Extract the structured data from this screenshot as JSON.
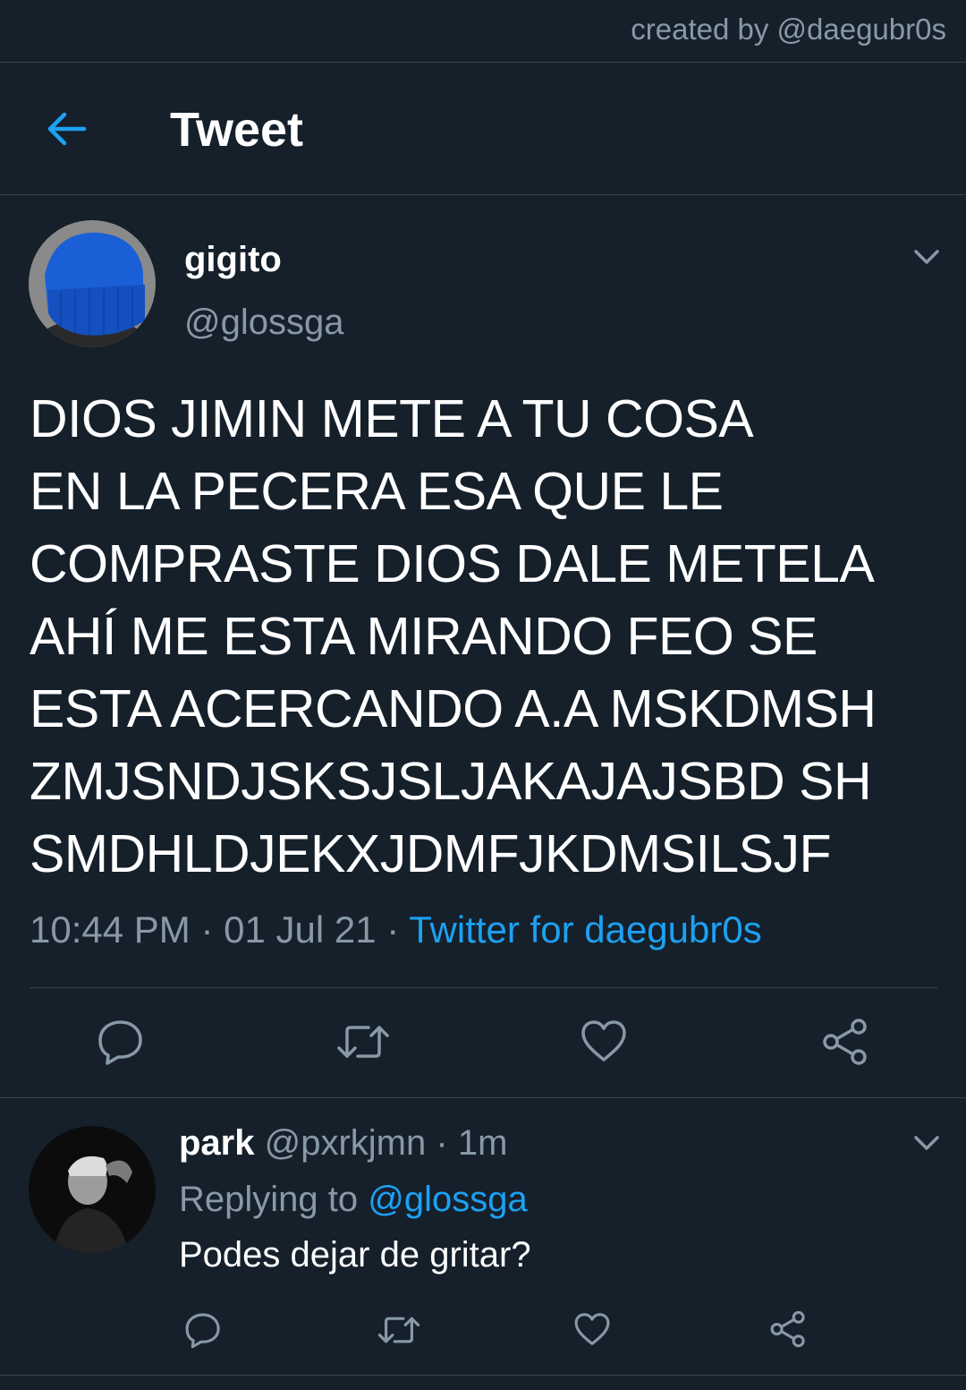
{
  "watermark": "created by @daegubr0s",
  "header": {
    "title": "Tweet",
    "back_icon": "arrow-left-icon"
  },
  "tweet": {
    "author": {
      "name": "gigito",
      "handle": "@glossga"
    },
    "lines": [
      "DIOS JIMIN METE A TU COSA",
      "EN LA PECERA ESA QUE LE",
      "COMPRASTE DIOS DALE METELA",
      "AHÍ ME ESTA MIRANDO FEO SE",
      "ESTA ACERCANDO A.A MSKDMSH",
      "ZMJSNDJSKSJSLJAKAJAJSBD SH",
      "SMDHLDJEKXJDMFJKDMSILSJF"
    ],
    "time": "10:44 PM",
    "sep": "·",
    "date": "01 Jul 21",
    "source": "Twitter for daegubr0s",
    "actions": [
      "reply-icon",
      "retweet-icon",
      "like-icon",
      "share-icon"
    ]
  },
  "reply": {
    "name": "park",
    "handle": "@pxrkjmn",
    "dot": "·",
    "time": "1m",
    "replying_prefix": "Replying to",
    "replying_to": "@glossga",
    "text": "Podes dejar de gritar?"
  },
  "colors": {
    "background": "#15202b",
    "accent": "#1da1f2",
    "secondary": "#8899a6",
    "divider": "#38444d"
  }
}
